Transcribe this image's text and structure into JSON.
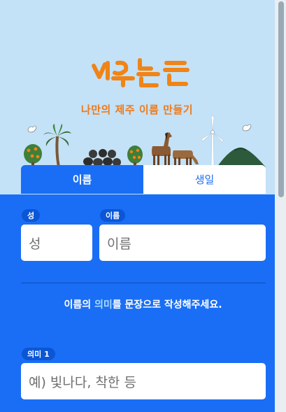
{
  "logo_alt": "제주는늘",
  "tagline": "나만의 제주 이름 만들기",
  "tabs": [
    {
      "label": "이름",
      "active": true
    },
    {
      "label": "생일",
      "active": false
    }
  ],
  "fields": {
    "surname": {
      "label": "성",
      "placeholder": "성"
    },
    "given_name": {
      "label": "이름",
      "placeholder": "이름"
    }
  },
  "description": {
    "prefix": "이름의 ",
    "highlight": "의미",
    "suffix": "를 문장으로 작성해주세요."
  },
  "meaning_fields": [
    {
      "label": "의미 1",
      "placeholder": "예) 빛나다, 착한 등"
    }
  ],
  "colors": {
    "primary": "#1a6ef5",
    "hero_bg": "#c3e1f7",
    "tagline": "#ef7a18",
    "badge": "#0b56d6"
  }
}
